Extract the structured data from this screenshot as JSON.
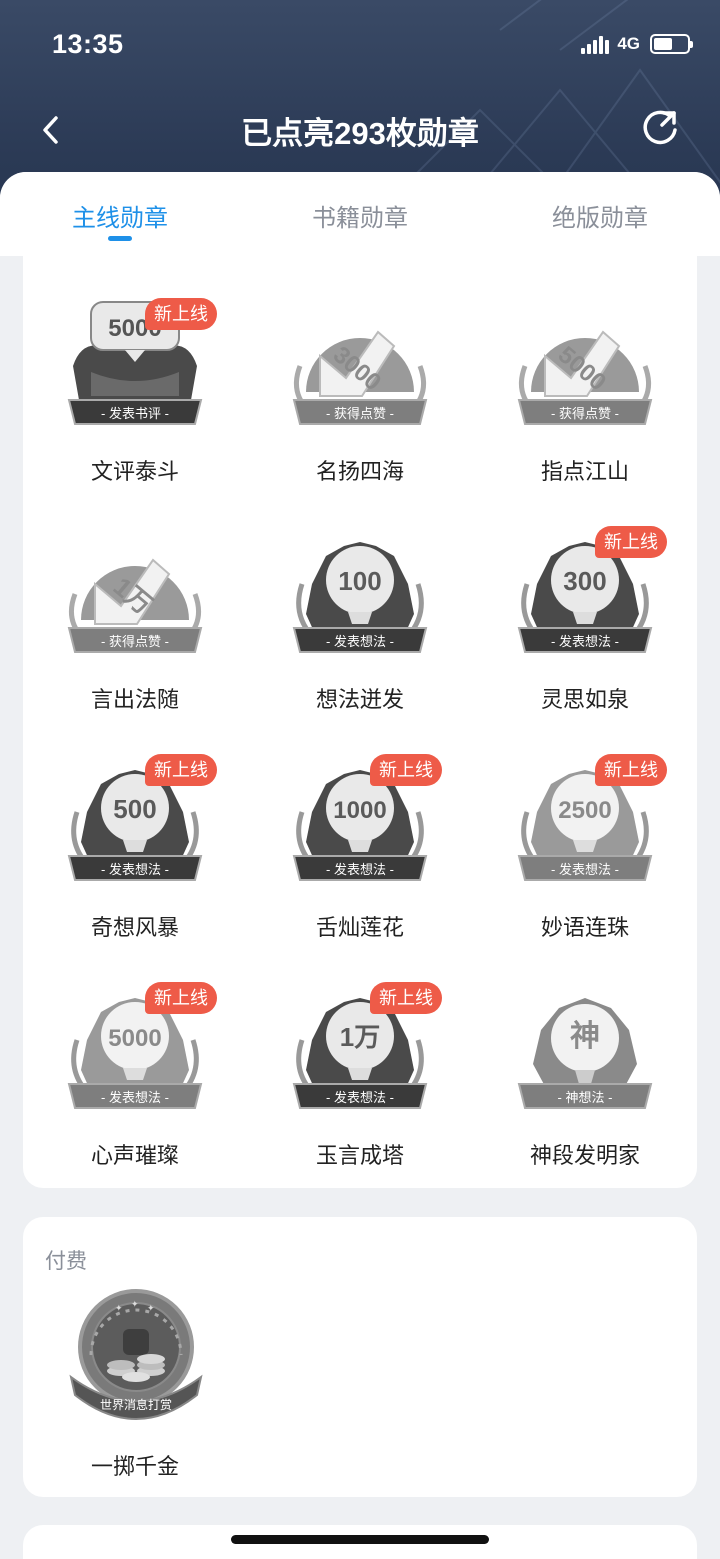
{
  "status_bar": {
    "time": "13:35",
    "network": "4G"
  },
  "nav": {
    "title": "已点亮293枚勋章"
  },
  "tabs": [
    {
      "label": "主线勋章",
      "active": true
    },
    {
      "label": "书籍勋章",
      "active": false
    },
    {
      "label": "绝版勋章",
      "active": false
    }
  ],
  "badges": [
    {
      "name": "文评泰斗",
      "value": "5000",
      "ribbon": "发表书评",
      "new_tag": "新上线"
    },
    {
      "name": "名扬四海",
      "value": "3000",
      "ribbon": "获得点赞",
      "new_tag": ""
    },
    {
      "name": "指点江山",
      "value": "5000",
      "ribbon": "获得点赞",
      "new_tag": ""
    },
    {
      "name": "言出法随",
      "value": "1万",
      "ribbon": "获得点赞",
      "new_tag": ""
    },
    {
      "name": "想法迸发",
      "value": "100",
      "ribbon": "发表想法",
      "new_tag": ""
    },
    {
      "name": "灵思如泉",
      "value": "300",
      "ribbon": "发表想法",
      "new_tag": "新上线"
    },
    {
      "name": "奇想风暴",
      "value": "500",
      "ribbon": "发表想法",
      "new_tag": "新上线"
    },
    {
      "name": "舌灿莲花",
      "value": "1000",
      "ribbon": "发表想法",
      "new_tag": "新上线"
    },
    {
      "name": "妙语连珠",
      "value": "2500",
      "ribbon": "发表想法",
      "new_tag": "新上线"
    },
    {
      "name": "心声璀璨",
      "value": "5000",
      "ribbon": "发表想法",
      "new_tag": "新上线"
    },
    {
      "name": "玉言成塔",
      "value": "1万",
      "ribbon": "发表想法",
      "new_tag": "新上线"
    },
    {
      "name": "神段发明家",
      "value": "神",
      "ribbon": "神想法",
      "new_tag": ""
    }
  ],
  "paid": {
    "label": "付费",
    "badge": {
      "name": "一掷千金",
      "ribbon": "世界消息打赏"
    }
  },
  "colors": {
    "accent": "#1e90e8",
    "new_tag": "#ee5b48",
    "header_bg": "#2b3a55"
  }
}
